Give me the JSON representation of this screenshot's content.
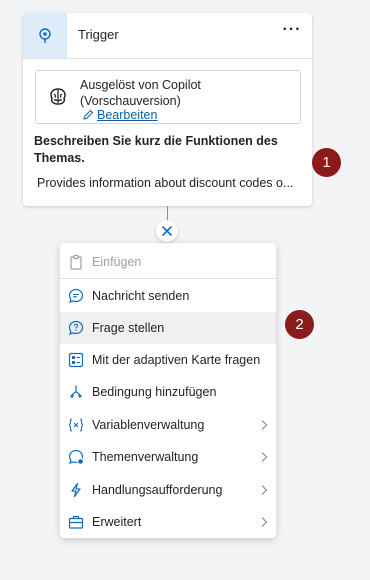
{
  "trigger": {
    "title": "Trigger",
    "more_label": "···",
    "source_title": "Ausgelöst von Copilot (Vorschauversion)",
    "edit_label": "Bearbeiten",
    "description_label": "Beschreiben Sie kurz die Funktionen des Themas.",
    "description_text": "Provides information about discount codes o..."
  },
  "badges": {
    "one": "1",
    "two": "2"
  },
  "menu": {
    "items": [
      {
        "label": "Einfügen",
        "icon": "clipboard-icon",
        "disabled": true
      },
      {
        "label": "Nachricht senden",
        "icon": "chat-bubble-icon"
      },
      {
        "label": "Frage stellen",
        "icon": "question-bubble-icon"
      },
      {
        "label": "Mit der adaptiven Karte fragen",
        "icon": "adaptive-card-icon"
      },
      {
        "label": "Bedingung hinzufügen",
        "icon": "branch-icon"
      },
      {
        "label": "Variablenverwaltung",
        "icon": "variable-icon",
        "submenu": true
      },
      {
        "label": "Themenverwaltung",
        "icon": "topic-gear-icon",
        "submenu": true
      },
      {
        "label": "Handlungsaufforderung",
        "icon": "lightning-icon",
        "submenu": true
      },
      {
        "label": "Erweitert",
        "icon": "toolbox-icon",
        "submenu": true
      }
    ]
  },
  "colors": {
    "accent": "#115ea3",
    "badge": "#8b1a1a",
    "icon_blue": "#0f6cbd",
    "highlight": "#f0f0f0"
  }
}
